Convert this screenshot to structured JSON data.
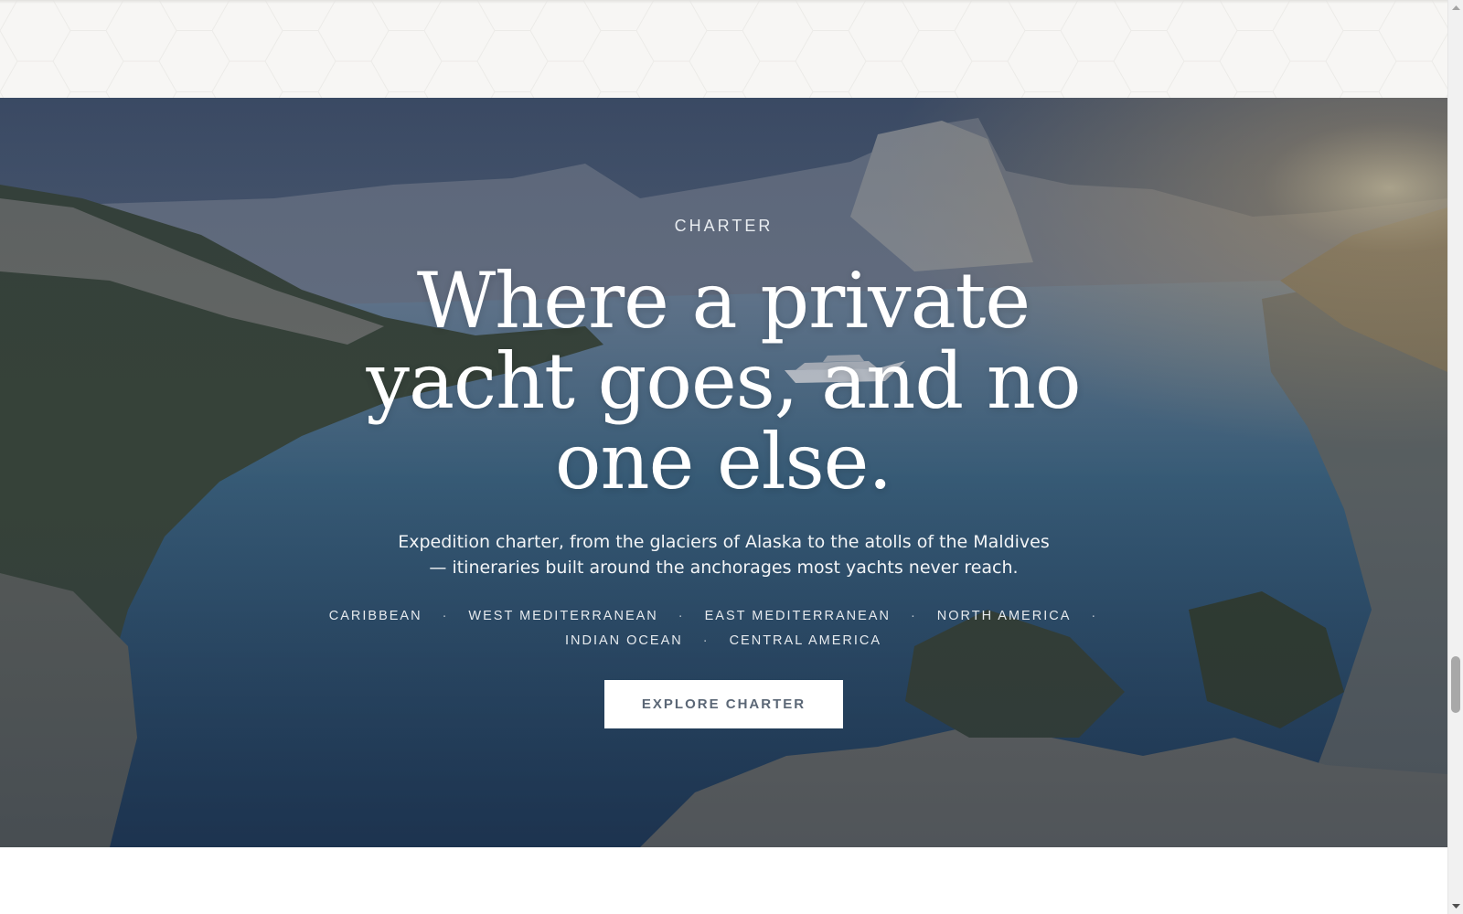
{
  "hero": {
    "eyebrow": "CHARTER",
    "headline_lines": [
      "Where a private",
      "yacht goes, and no",
      "one else."
    ],
    "subtext_lines": [
      "Expedition charter, from the glaciers of Alaska to the atolls of the Maldives",
      "— itineraries built around the anchorages most yachts never reach."
    ],
    "separator": "·",
    "regions_row1": [
      "CARIBBEAN",
      "WEST MEDITERRANEAN",
      "EAST MEDITERRANEAN",
      "NORTH AMERICA"
    ],
    "regions_row2": [
      "INDIAN OCEAN",
      "CENTRAL AMERICA"
    ],
    "cta_label": "EXPLORE CHARTER",
    "background_image": "mediterranean-cove-with-yacht-at-sunset"
  },
  "scrollbar": {
    "up_icon": "scroll-up-arrow-icon",
    "down_icon": "scroll-down-arrow-icon"
  },
  "colors": {
    "top_band": "#f7f6f4",
    "overlay": "#1d2b44",
    "cta_background": "#ffffff",
    "cta_text": "#5b6776"
  }
}
